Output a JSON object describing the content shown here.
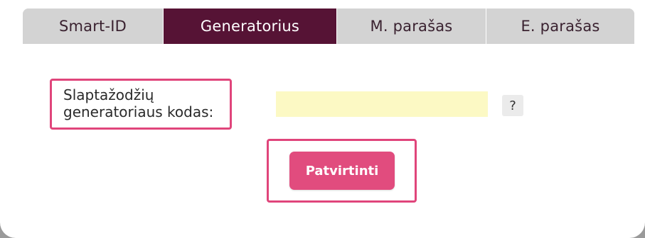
{
  "tabs": [
    {
      "label": "Smart-ID",
      "active": false
    },
    {
      "label": "Generatorius",
      "active": true
    },
    {
      "label": "M. parašas",
      "active": false
    },
    {
      "label": "E. parašas",
      "active": false
    }
  ],
  "form": {
    "code_label": "Slaptažodžių generatoriaus kodas:",
    "code_value": "",
    "help_label": "?",
    "submit_label": "Patvirtinti"
  },
  "colors": {
    "tab_active_bg": "#561335",
    "tab_inactive_bg": "#d3d3d3",
    "input_bg": "#fcf9c4",
    "accent": "#e14c7e",
    "highlight_border": "#e0457b"
  }
}
